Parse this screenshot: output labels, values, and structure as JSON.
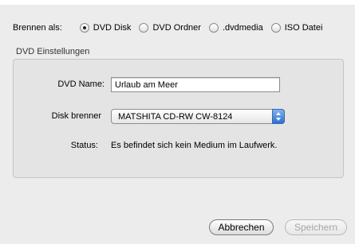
{
  "burn_as": {
    "label": "Brennen als:",
    "options": [
      {
        "label": "DVD Disk",
        "selected": true
      },
      {
        "label": "DVD Ordner",
        "selected": false
      },
      {
        "label": ".dvdmedia",
        "selected": false
      },
      {
        "label": "ISO Datei",
        "selected": false
      }
    ]
  },
  "settings": {
    "group_title": "DVD Einstellungen",
    "name_label": "DVD Name:",
    "name_value": "Urlaub am Meer",
    "burner_label": "Disk brenner",
    "burner_value": "MATSHITA CD-RW CW-8124",
    "status_label": "Status:",
    "status_value": "Es befindet sich kein Medium im Laufwerk."
  },
  "buttons": {
    "cancel": "Abbrechen",
    "save": "Speichern"
  },
  "colors": {
    "window_bg": "#ececec",
    "group_bg": "#e4e4e4",
    "stepper_blue": "#2d6fd2",
    "disabled_text": "#a7a7a7"
  },
  "icons": {
    "radio_selected": "radio-selected-icon",
    "radio_unselected": "radio-unselected-icon",
    "stepper": "up-down-stepper-icon"
  }
}
